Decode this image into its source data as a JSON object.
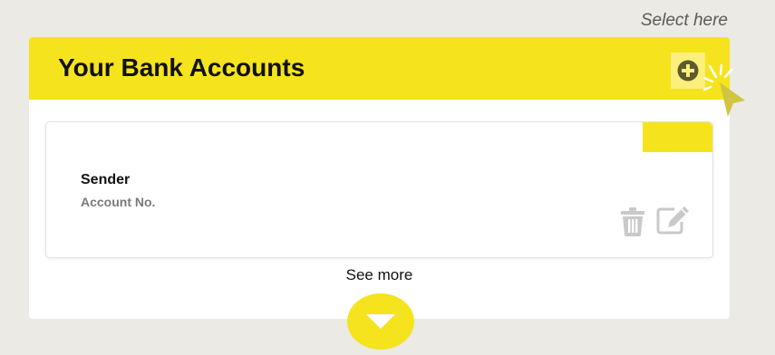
{
  "hint": {
    "text": "Select here"
  },
  "panel": {
    "title": "Your Bank Accounts",
    "add_icon": "plus-circle-icon"
  },
  "account_card": {
    "sender": "Sender",
    "account_no": "Account No.",
    "delete_icon": "trash-icon",
    "edit_icon": "edit-icon"
  },
  "footer": {
    "see_more": "See more",
    "expand_icon": "chevron-down-icon"
  },
  "colors": {
    "accent": "#f5e31e",
    "accent_light": "#fbf07c",
    "background": "#ebeae4",
    "icon_muted": "#c9c9c9"
  }
}
